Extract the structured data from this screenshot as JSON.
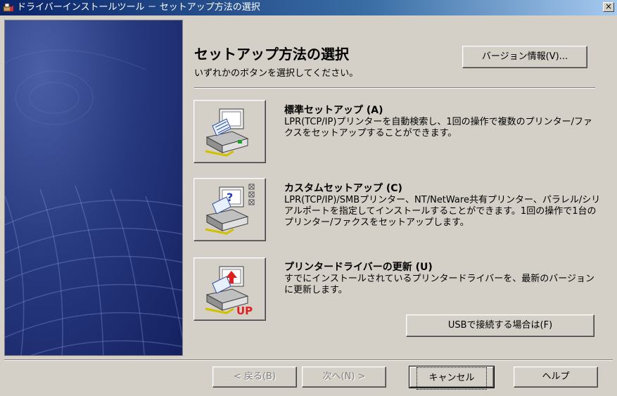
{
  "window": {
    "title": "ドライバーインストールツール － セットアップ方法の選択",
    "close_label": "×"
  },
  "header": {
    "title": "セットアップ方法の選択",
    "subtitle": "いずれかのボタンを選択してください。",
    "version_button": "バージョン情報(V)..."
  },
  "options": [
    {
      "title": "標準セットアップ (A)",
      "description": "LPR(TCP/IP)プリンターを自動検索し、1回の操作で複数のプリンター/ファクスをセットアップすることができます。"
    },
    {
      "title": "カスタムセットアップ (C)",
      "description": "LPR(TCP/IP)/SMBプリンター、NT/NetWare共有プリンター、パラレル/シリアルポートを指定してインストールすることができます。1回の操作で1台のプリンター/ファクスをセットアップします。"
    },
    {
      "title": "プリンタードライバーの更新 (U)",
      "description": "すでにインストールされているプリンタードライバーを、最新のバージョンに更新します。"
    }
  ],
  "custom_icon_marks": [
    "?",
    "UP"
  ],
  "usb_button": "USBで接続する場合は(F)",
  "footer": {
    "back": "< 戻る(B)",
    "next": "次へ(N) >",
    "cancel": "キャンセル",
    "help": "ヘルプ"
  }
}
